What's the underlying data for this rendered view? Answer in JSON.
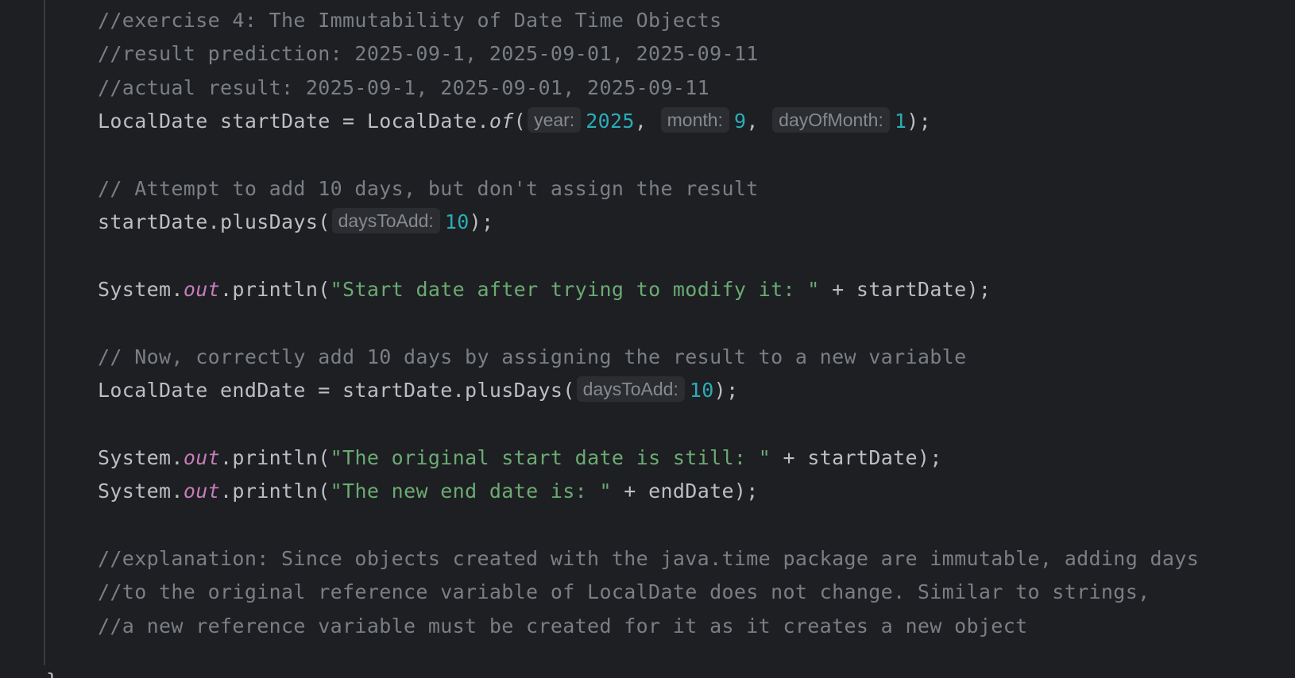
{
  "editor": {
    "comment_exercise": "//exercise 4: The Immutability of Date Time Objects",
    "comment_prediction": "//result prediction: 2025-09-1, 2025-09-01, 2025-09-11",
    "comment_actual": "//actual result: 2025-09-1, 2025-09-01, 2025-09-11",
    "line_localdate": {
      "decl": "LocalDate startDate = LocalDate.",
      "method": "of",
      "open": "(",
      "hint_year": "year:",
      "val_year": "2025",
      "sep1": ", ",
      "hint_month": "month:",
      "val_month": "9",
      "sep2": ", ",
      "hint_day": "dayOfMonth:",
      "val_day": "1",
      "close": ");"
    },
    "comment_attempt": "// Attempt to add 10 days, but don't assign the result",
    "line_plusdays": {
      "code": "startDate.plusDays(",
      "hint": "daysToAdd:",
      "value": "10",
      "close": ");"
    },
    "line_println_start": {
      "prefix": "System.",
      "field": "out",
      "call": ".println(",
      "string": "\"Start date after trying to modify it: \"",
      "rest": " + startDate);"
    },
    "comment_now": "// Now, correctly add 10 days by assigning the result to a new variable",
    "line_enddate": {
      "code": "LocalDate endDate = startDate.plusDays(",
      "hint": "daysToAdd:",
      "value": "10",
      "close": ");"
    },
    "line_println_original": {
      "prefix": "System.",
      "field": "out",
      "call": ".println(",
      "string": "\"The original start date is still: \"",
      "rest": " + startDate);"
    },
    "line_println_new": {
      "prefix": "System.",
      "field": "out",
      "call": ".println(",
      "string": "\"The new end date is: \"",
      "rest": " + endDate);"
    },
    "comment_explanation_1": "//explanation: Since objects created with the java.time package are immutable, adding days",
    "comment_explanation_2": "//to the original reference variable of LocalDate does not change. Similar to strings,",
    "comment_explanation_3": "//a new reference variable must be created for it as it creates a new object",
    "closing_brace": "}"
  },
  "colors": {
    "background": "#1e1f22",
    "default_text": "#bcbec4",
    "comment": "#7a7e85",
    "string": "#6aab73",
    "number": "#2aacb8",
    "static_field": "#c77dbb",
    "inlay_hint_bg": "#2b2d30",
    "inlay_hint_text": "#868a91"
  }
}
